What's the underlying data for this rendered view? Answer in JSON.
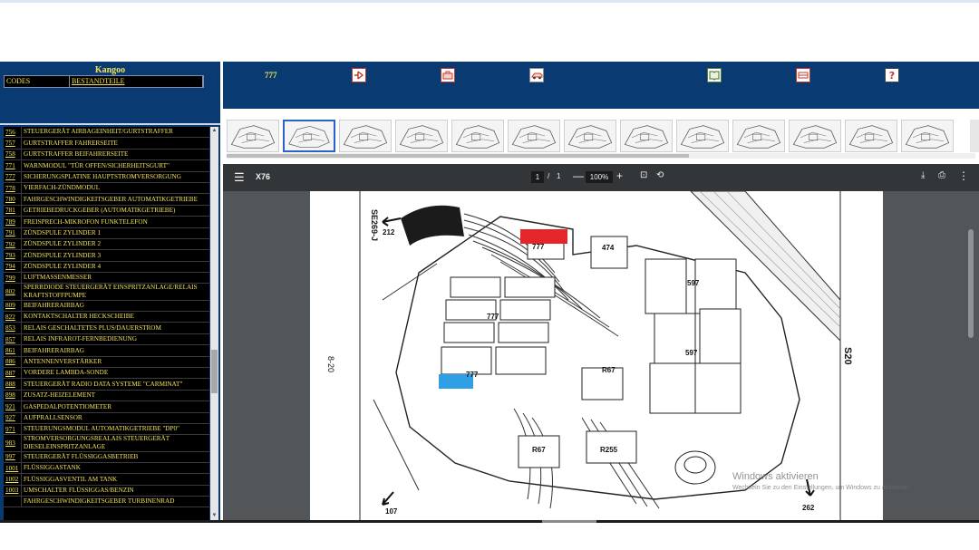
{
  "left_panel": {
    "title": "Kangoo",
    "tabs": {
      "codes": "CODES",
      "components": "BESTANDTEILE"
    },
    "items": [
      {
        "code": "756",
        "name": "STEUERGERÄT AIRBAGEINHEIT/GURTSTRAFFER"
      },
      {
        "code": "757",
        "name": "GURTSTRAFFER FAHRERSEITE"
      },
      {
        "code": "758",
        "name": "GURTSTRAFFER BEIFAHRERSEITE"
      },
      {
        "code": "771",
        "name": "WARNMODUL \"TÜR OFFEN/SICHERHEITSGURT\""
      },
      {
        "code": "777",
        "name": "SICHERUNGSPLATINE HAUPTSTROMVERSORGUNG"
      },
      {
        "code": "778",
        "name": "VIERFACH-ZÜNDMODUL"
      },
      {
        "code": "780",
        "name": "FAHRGESCHWINDIGKEITSGEBER AUTOMATIKGETRIEBE"
      },
      {
        "code": "781",
        "name": "GETRIEBEDRUCKGEBER (AUTOMATIKGETRIEBE)"
      },
      {
        "code": "789",
        "name": "FREISPRECH-MIKROFON FUNKTELEFON"
      },
      {
        "code": "791",
        "name": "ZÜNDSPULE ZYLINDER 1"
      },
      {
        "code": "792",
        "name": "ZÜNDSPULE ZYLINDER 2"
      },
      {
        "code": "793",
        "name": "ZÜNDSPULE ZYLINDER 3"
      },
      {
        "code": "794",
        "name": "ZÜNDSPULE ZYLINDER 4"
      },
      {
        "code": "799",
        "name": "LUFTMASSENMESSER"
      },
      {
        "code": "802",
        "name": "SPERRDIODE STEUERGERÄT EINSPRITZANLAGE/RELAIS KRAFTSTOFFPUMPE"
      },
      {
        "code": "809",
        "name": "BEIFAHRERAIRBAG"
      },
      {
        "code": "822",
        "name": "KONTAKTSCHALTER HECKSCHEIBE"
      },
      {
        "code": "853",
        "name": "RELAIS GESCHALTETES PLUS/DAUERSTROM"
      },
      {
        "code": "857",
        "name": "RELAIS INFRAROT-FERNBEDIENUNG"
      },
      {
        "code": "861",
        "name": "BEIFAHRERAIRBAG"
      },
      {
        "code": "886",
        "name": "ANTENNENVERSTÄRKER"
      },
      {
        "code": "887",
        "name": "VORDERE LAMBDA-SONDE"
      },
      {
        "code": "888",
        "name": "STEUERGERÄT RADIO DATA SYSTEME \"CARMINAT\""
      },
      {
        "code": "898",
        "name": "ZUSATZ-HEIZELEMENT"
      },
      {
        "code": "921",
        "name": "GASPEDALPOTENTIOMETER"
      },
      {
        "code": "927",
        "name": "AUFPRALLSENSOR"
      },
      {
        "code": "971",
        "name": "STEUERUNGSMODUL AUTOMATIKGETRIEBE \"DP0\""
      },
      {
        "code": "983",
        "name": "STROMVERSORGUNGSREALAIS STEUERGERÄT DIESELEINSPRITZANLAGE"
      },
      {
        "code": "997",
        "name": "STEUERGERÄT FLÜSSIGGASBETRIEB"
      },
      {
        "code": "1001",
        "name": "FLÜSSIGGASTANK"
      },
      {
        "code": "1002",
        "name": "FLÜSSIGGASVENTIL AM TANK"
      },
      {
        "code": "1003",
        "name": "UMSCHALTER FLÜSSIGGAS/BENZIN"
      },
      {
        "code": "",
        "name": "FAHRGESCHWINDIGKEITSGEBER TURBINENRAD"
      }
    ]
  },
  "toolbar": {
    "selected_code": "777",
    "icons": [
      "connector-icon",
      "toolbox-icon",
      "car-icon",
      "book-icon",
      "fuse-box-icon",
      "help-icon"
    ]
  },
  "pdf": {
    "title": "X76",
    "page_current": "1",
    "page_separator": "/",
    "page_total": "1",
    "zoom": "100%",
    "menu_glyph": "☰",
    "minus_glyph": "—",
    "plus_glyph": "+",
    "fit_glyph": "⊡",
    "rotate_glyph": "⟲",
    "download_glyph": "⤓",
    "print_glyph": "⎙",
    "more_glyph": "⋮"
  },
  "diagram": {
    "labels": {
      "ref": "SE269-J",
      "side_left": "8-20",
      "side_right": "S20",
      "arrow_top": "212",
      "arrow_bottom_left": "107",
      "arrow_bottom_right": "262",
      "red_label": "777",
      "blue_label": "777",
      "center_label": "777",
      "relay_474": "474",
      "relay_597a": "597",
      "relay_597b": "597",
      "r67a": "R67",
      "r67b": "R67",
      "r255": "R255"
    },
    "highlight_colors": {
      "red": "#e5252a",
      "blue": "#2f9fe6"
    }
  },
  "system": {
    "watermark_title": "Windows aktivieren",
    "watermark_sub": "Wechseln Sie zu den Einstellungen, um Windows zu aktivieren."
  }
}
